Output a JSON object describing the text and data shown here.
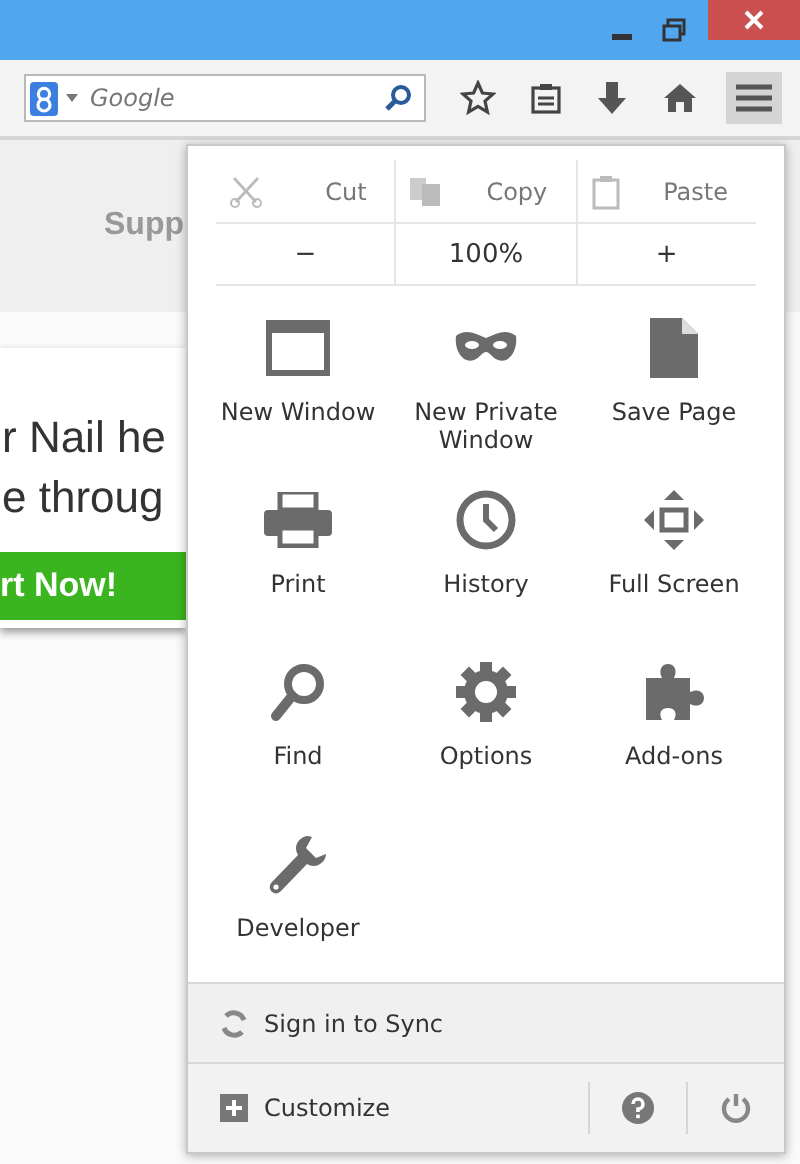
{
  "toolbar": {
    "search": {
      "placeholder": "Google"
    }
  },
  "page": {
    "nav_fragment": "Supp",
    "headline_lines": [
      "r Nail he",
      "e throug"
    ],
    "cta": "rt Now!"
  },
  "menu": {
    "edit_row": [
      {
        "label": "Cut",
        "disabled": true
      },
      {
        "label": "Copy",
        "disabled": true
      },
      {
        "label": "Paste",
        "disabled": true
      }
    ],
    "zoom": {
      "minus": "−",
      "level": "100%",
      "plus": "+"
    },
    "items": [
      {
        "label": "New Window"
      },
      {
        "label": "New Private Window"
      },
      {
        "label": "Save Page"
      },
      {
        "label": "Print"
      },
      {
        "label": "History"
      },
      {
        "label": "Full Screen"
      },
      {
        "label": "Find"
      },
      {
        "label": "Options"
      },
      {
        "label": "Add-ons"
      },
      {
        "label": "Developer"
      }
    ],
    "sync": {
      "label": "Sign in to Sync"
    },
    "customize": {
      "label": "Customize"
    }
  }
}
